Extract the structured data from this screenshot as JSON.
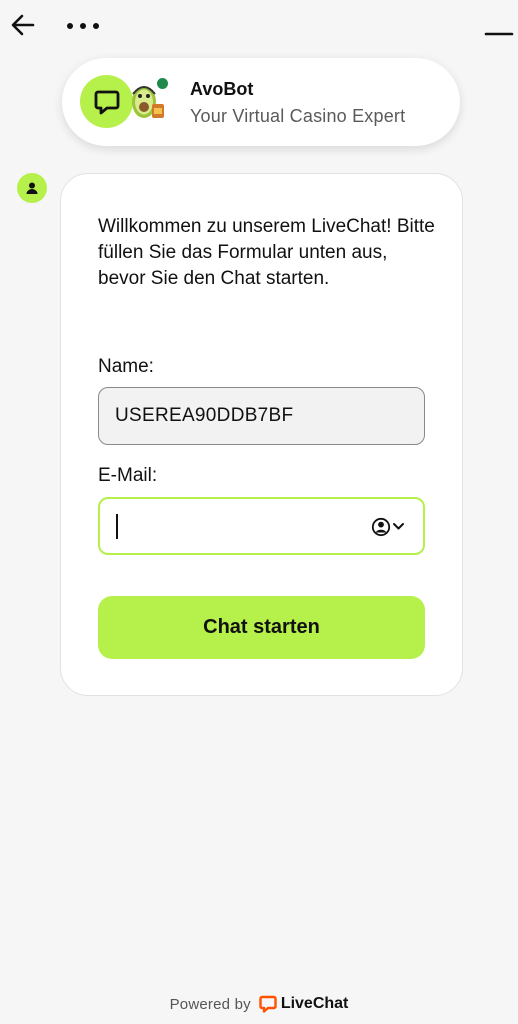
{
  "header": {
    "back_icon": "arrow-left-icon",
    "more_icon": "more-horizontal-icon",
    "minimize_icon": "minimize-icon"
  },
  "agent": {
    "name": "AvoBot",
    "subtitle": "Your Virtual Casino Expert",
    "status": "online",
    "brand_color": "#b6f04a",
    "status_color": "#1f8a4c"
  },
  "message": {
    "text": "Willkommen zu unserem LiveChat! Bitte füllen Sie das Formular unten aus, bevor Sie den Chat starten."
  },
  "form": {
    "name_label": "Name:",
    "name_value": "USEREA90DDB7BF",
    "email_label": "E-Mail:",
    "email_value": "",
    "submit_label": "Chat starten"
  },
  "footer": {
    "powered_by": "Powered by",
    "brand": "LiveChat",
    "brand_color": "#ff5100"
  }
}
